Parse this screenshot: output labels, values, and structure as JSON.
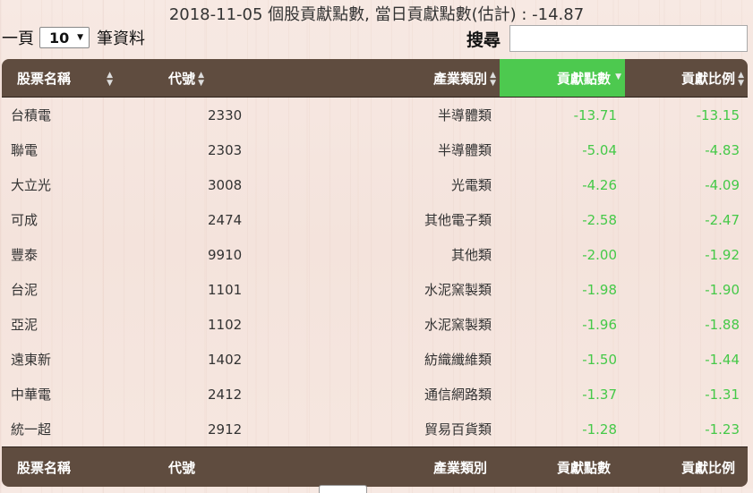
{
  "title": "2018-11-05 個股貢獻點數, 當日貢獻點數(估計) : -14.87",
  "length_control": {
    "prefix": "一頁",
    "value": "10",
    "suffix": "筆資料"
  },
  "search": {
    "label": "搜尋",
    "value": ""
  },
  "columns": [
    {
      "label": "股票名稱"
    },
    {
      "label": "代號"
    },
    {
      "label": "產業類別"
    },
    {
      "label": "貢獻點數"
    },
    {
      "label": "貢獻比例"
    }
  ],
  "sort_column": "貢獻點數",
  "colors": {
    "header_bg": "#5f4c3f",
    "sorted_header_bg": "#4dc94f",
    "negative_value": "#45c948"
  },
  "rows": [
    {
      "name": "台積電",
      "code": "2330",
      "industry": "半導體類",
      "points": "-13.71",
      "pct": "-13.15"
    },
    {
      "name": "聯電",
      "code": "2303",
      "industry": "半導體類",
      "points": "-5.04",
      "pct": "-4.83"
    },
    {
      "name": "大立光",
      "code": "3008",
      "industry": "光電類",
      "points": "-4.26",
      "pct": "-4.09"
    },
    {
      "name": "可成",
      "code": "2474",
      "industry": "其他電子類",
      "points": "-2.58",
      "pct": "-2.47"
    },
    {
      "name": "豐泰",
      "code": "9910",
      "industry": "其他類",
      "points": "-2.00",
      "pct": "-1.92"
    },
    {
      "name": "台泥",
      "code": "1101",
      "industry": "水泥窯製類",
      "points": "-1.98",
      "pct": "-1.90"
    },
    {
      "name": "亞泥",
      "code": "1102",
      "industry": "水泥窯製類",
      "points": "-1.96",
      "pct": "-1.88"
    },
    {
      "name": "遠東新",
      "code": "1402",
      "industry": "紡織纖維類",
      "points": "-1.50",
      "pct": "-1.44"
    },
    {
      "name": "中華電",
      "code": "2412",
      "industry": "通信網路類",
      "points": "-1.37",
      "pct": "-1.31"
    },
    {
      "name": "統一超",
      "code": "2912",
      "industry": "貿易百貨類",
      "points": "-1.28",
      "pct": "-1.23"
    }
  ]
}
